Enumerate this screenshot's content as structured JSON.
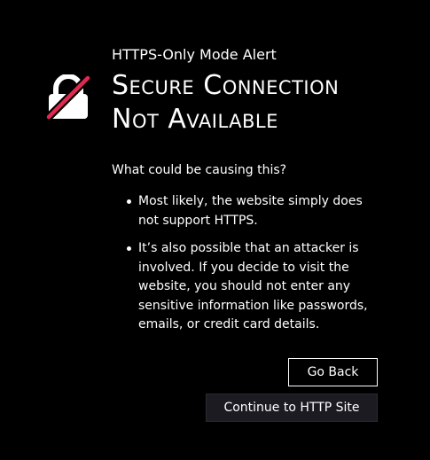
{
  "alert": {
    "subtitle": "HTTPS-Only Mode Alert",
    "title_line1": "Secure Connection",
    "title_line2": "Not Available",
    "icon": "broken-lock-icon",
    "question": "What could be causing this?",
    "reasons": [
      "Most likely, the website simply does not support HTTPS.",
      "It’s also possible that an attacker is involved. If you decide to visit the website, you should not enter any sensitive information like passwords, emails, or credit card details."
    ]
  },
  "actions": {
    "go_back_label": "Go Back",
    "continue_label": "Continue to HTTP Site"
  },
  "colors": {
    "background": "#000000",
    "text": "#ffffff",
    "slash": "#e22850",
    "secondary_button_bg": "#1c1b22"
  }
}
